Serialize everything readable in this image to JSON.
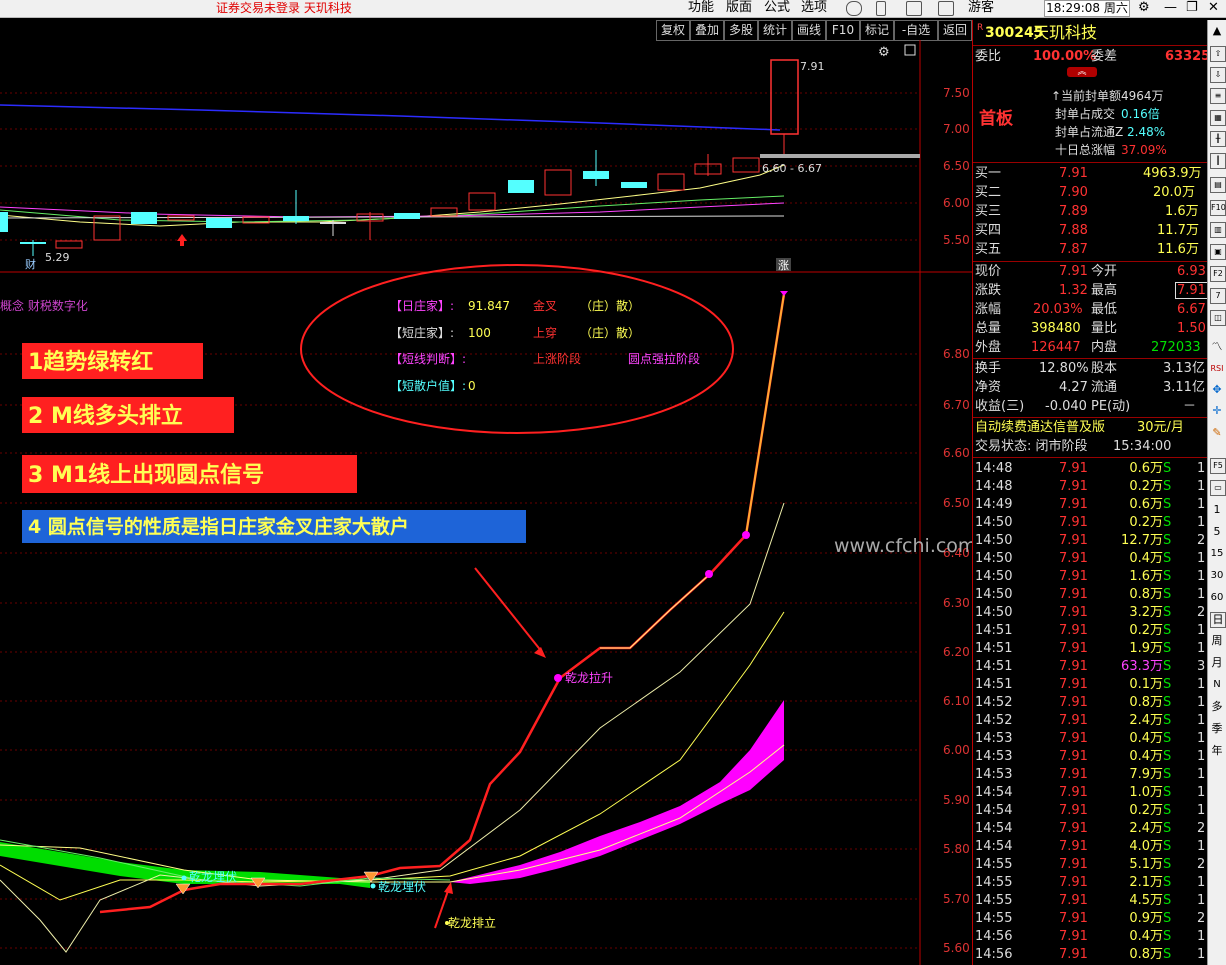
{
  "topbar": {
    "status": "证券交易未登录  天玑科技",
    "menus": [
      "功能",
      "版面",
      "公式",
      "选项"
    ],
    "user": "游客",
    "clock": "18:29:08 周六"
  },
  "toolbar": [
    "复权",
    "叠加",
    "多股",
    "统计",
    "画线",
    "F10",
    "标记",
    "-自选",
    "返回"
  ],
  "chart": {
    "price_axis": [
      "7.50",
      "7.00",
      "6.50",
      "6.00",
      "5.50"
    ],
    "ind_axis": [
      "6.80",
      "6.70",
      "6.60",
      "6.50",
      "6.40",
      "6.30",
      "6.20",
      "6.10",
      "6.00",
      "5.90",
      "5.80",
      "5.70",
      "5.60"
    ],
    "high_label": "7.91",
    "low_label": "5.29",
    "range_label": "6.60 - 6.67",
    "cai": "财",
    "zhang": "涨",
    "indicator_name": "概念 财税数字化",
    "info": [
      {
        "k": "【日庄家】:",
        "v": "91.847",
        "s": "金叉",
        "t": "（庄）散）"
      },
      {
        "k": "【短庄家】:",
        "v": "100",
        "s": "上穿",
        "t": "（庄）散）"
      },
      {
        "k": "【短线判断】:",
        "v": "",
        "s": "上涨阶段",
        "t": "圆点强拉阶段"
      },
      {
        "k": "【短散户值】:",
        "v": "0",
        "s": "",
        "t": ""
      }
    ],
    "anno": [
      "1趋势绿转红",
      "2 M线多头排立",
      "3  M1线上出现圆点信号",
      "4 圆点信号的性质是指日庄家金叉庄家大散户"
    ],
    "labels": {
      "lift": "乾龙拉升",
      "hide1": "乾龙埋伏",
      "hide2": "乾龙埋伏",
      "arrange": "乾龙排立",
      "watermark": "www.cfchi.com"
    }
  },
  "quote": {
    "code": "300245",
    "name": "天玑科技",
    "r": "R",
    "wb_label": "委比",
    "wb": "100.00%",
    "wc_label": "委差",
    "wc": "63325",
    "tag": "首板",
    "seal": [
      {
        "l": "↑当前封单额",
        "v": "4964万"
      },
      {
        "l": "封单占成交",
        "v": "0.16倍"
      },
      {
        "l": "封单占流通Z",
        "v": "2.48%"
      },
      {
        "l": "十日总涨幅",
        "v": "37.09%"
      }
    ],
    "bids": [
      {
        "l": "买一",
        "p": "7.91",
        "v": "4963.9万"
      },
      {
        "l": "买二",
        "p": "7.90",
        "v": "20.0万"
      },
      {
        "l": "买三",
        "p": "7.89",
        "v": "1.6万"
      },
      {
        "l": "买四",
        "p": "7.88",
        "v": "11.7万"
      },
      {
        "l": "买五",
        "p": "7.87",
        "v": "11.6万"
      }
    ],
    "stats": [
      {
        "a": "现价",
        "b": "7.91",
        "c": "今开",
        "d": "6.93"
      },
      {
        "a": "涨跌",
        "b": "1.32",
        "c": "最高",
        "d": "7.91"
      },
      {
        "a": "涨幅",
        "b": "20.03%",
        "c": "最低",
        "d": "6.67"
      },
      {
        "a": "总量",
        "b": "398480",
        "c": "量比",
        "d": "1.50"
      },
      {
        "a": "外盘",
        "b": "126447",
        "c": "内盘",
        "d": "272033"
      }
    ],
    "stats2": [
      {
        "a": "换手",
        "b": "12.80%",
        "c": "股本",
        "d": "3.13亿"
      },
      {
        "a": "净资",
        "b": "4.27",
        "c": "流通",
        "d": "3.11亿"
      },
      {
        "a": "收益(三)",
        "b": "-0.040",
        "c": "PE(动)",
        "d": "－"
      }
    ],
    "ad": "自动续费通达信普及版",
    "price": "30元/月",
    "trade_state": "交易状态: 闭市阶段",
    "trade_time": "15:34:00",
    "ticks": [
      [
        "14:48",
        "7.91",
        "0.6万",
        "S",
        "1"
      ],
      [
        "14:48",
        "7.91",
        "0.2万",
        "S",
        "1"
      ],
      [
        "14:49",
        "7.91",
        "0.6万",
        "S",
        "1"
      ],
      [
        "14:50",
        "7.91",
        "0.2万",
        "S",
        "1"
      ],
      [
        "14:50",
        "7.91",
        "12.7万",
        "S",
        "2"
      ],
      [
        "14:50",
        "7.91",
        "0.4万",
        "S",
        "1"
      ],
      [
        "14:50",
        "7.91",
        "1.6万",
        "S",
        "1"
      ],
      [
        "14:50",
        "7.91",
        "0.8万",
        "S",
        "1"
      ],
      [
        "14:50",
        "7.91",
        "3.2万",
        "S",
        "2"
      ],
      [
        "14:51",
        "7.91",
        "0.2万",
        "S",
        "1"
      ],
      [
        "14:51",
        "7.91",
        "1.9万",
        "S",
        "1"
      ],
      [
        "14:51",
        "7.91",
        "63.3万",
        "S",
        "3"
      ],
      [
        "14:51",
        "7.91",
        "0.1万",
        "S",
        "1"
      ],
      [
        "14:52",
        "7.91",
        "0.8万",
        "S",
        "1"
      ],
      [
        "14:52",
        "7.91",
        "2.4万",
        "S",
        "1"
      ],
      [
        "14:53",
        "7.91",
        "0.4万",
        "S",
        "1"
      ],
      [
        "14:53",
        "7.91",
        "0.4万",
        "S",
        "1"
      ],
      [
        "14:53",
        "7.91",
        "7.9万",
        "S",
        "1"
      ],
      [
        "14:54",
        "7.91",
        "1.0万",
        "S",
        "1"
      ],
      [
        "14:54",
        "7.91",
        "0.2万",
        "S",
        "1"
      ],
      [
        "14:54",
        "7.91",
        "2.4万",
        "S",
        "2"
      ],
      [
        "14:54",
        "7.91",
        "4.0万",
        "S",
        "1"
      ],
      [
        "14:55",
        "7.91",
        "5.1万",
        "S",
        "2"
      ],
      [
        "14:55",
        "7.91",
        "2.1万",
        "S",
        "1"
      ],
      [
        "14:55",
        "7.91",
        "4.5万",
        "S",
        "1"
      ],
      [
        "14:55",
        "7.91",
        "0.9万",
        "S",
        "2"
      ],
      [
        "14:56",
        "7.91",
        "0.4万",
        "S",
        "1"
      ],
      [
        "14:56",
        "7.91",
        "0.8万",
        "S",
        "1"
      ]
    ]
  },
  "sidebar": [
    "1",
    "5",
    "15",
    "30",
    "60",
    "日",
    "周",
    "月",
    "N",
    "多",
    "季",
    "年"
  ],
  "colors": {
    "up": "#ff3232",
    "down": "#54ffff",
    "yellow": "#ffff54",
    "magenta": "#ff00ff",
    "green": "#00e000"
  }
}
